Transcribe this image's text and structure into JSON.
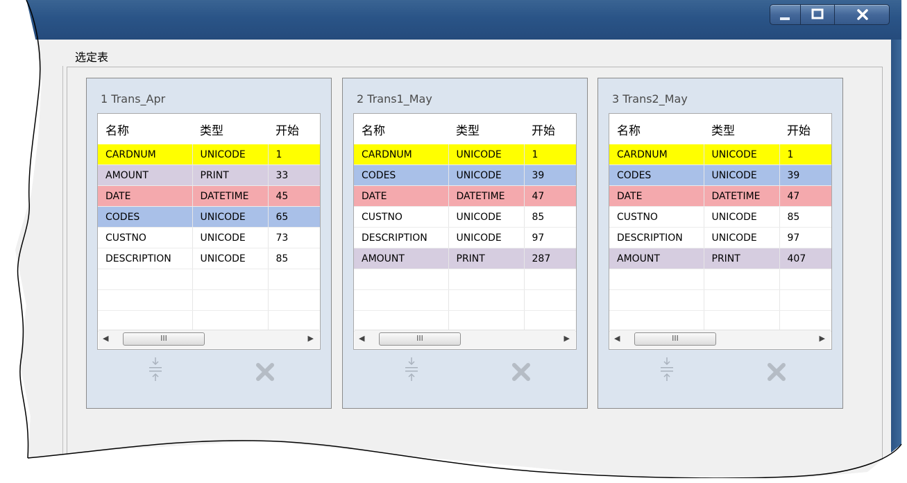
{
  "section_title": "选定表",
  "window_buttons": {
    "minimize": "—",
    "maximize": "▢",
    "close": "X"
  },
  "columns": [
    "名称",
    "类型",
    "开始"
  ],
  "scroll_thumb_grip": "III",
  "row_colors": {
    "yellow": "#ffff00",
    "purple": "#d6cde0",
    "red": "#f4a9ad",
    "blue": "#a9c0e8",
    "white": "#ffffff"
  },
  "panels": [
    {
      "title": "1 Trans_Apr",
      "rows": [
        {
          "name": "CARDNUM",
          "type": "UNICODE",
          "start": "1",
          "color": "yellow"
        },
        {
          "name": "AMOUNT",
          "type": "PRINT",
          "start": "33",
          "color": "purple"
        },
        {
          "name": "DATE",
          "type": "DATETIME",
          "start": "45",
          "color": "red"
        },
        {
          "name": "CODES",
          "type": "UNICODE",
          "start": "65",
          "color": "blue"
        },
        {
          "name": "CUSTNO",
          "type": "UNICODE",
          "start": "73",
          "color": "white"
        },
        {
          "name": "DESCRIPTION",
          "type": "UNICODE",
          "start": "85",
          "color": "white"
        }
      ]
    },
    {
      "title": "2 Trans1_May",
      "rows": [
        {
          "name": "CARDNUM",
          "type": "UNICODE",
          "start": "1",
          "color": "yellow"
        },
        {
          "name": "CODES",
          "type": "UNICODE",
          "start": "39",
          "color": "blue"
        },
        {
          "name": "DATE",
          "type": "DATETIME",
          "start": "47",
          "color": "red"
        },
        {
          "name": "CUSTNO",
          "type": "UNICODE",
          "start": "85",
          "color": "white"
        },
        {
          "name": "DESCRIPTION",
          "type": "UNICODE",
          "start": "97",
          "color": "white"
        },
        {
          "name": "AMOUNT",
          "type": "PRINT",
          "start": "287",
          "color": "purple"
        }
      ]
    },
    {
      "title": "3 Trans2_May",
      "rows": [
        {
          "name": "CARDNUM",
          "type": "UNICODE",
          "start": "1",
          "color": "yellow"
        },
        {
          "name": "CODES",
          "type": "UNICODE",
          "start": "39",
          "color": "blue"
        },
        {
          "name": "DATE",
          "type": "DATETIME",
          "start": "47",
          "color": "red"
        },
        {
          "name": "CUSTNO",
          "type": "UNICODE",
          "start": "85",
          "color": "white"
        },
        {
          "name": "DESCRIPTION",
          "type": "UNICODE",
          "start": "97",
          "color": "white"
        },
        {
          "name": "AMOUNT",
          "type": "PRINT",
          "start": "407",
          "color": "purple"
        }
      ]
    }
  ]
}
